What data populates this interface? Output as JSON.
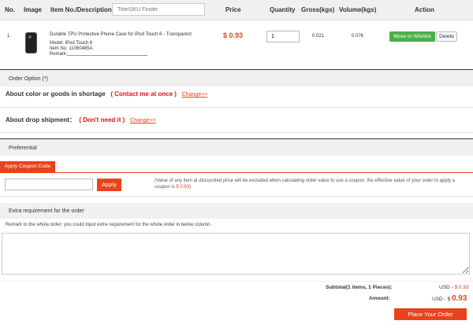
{
  "header": {
    "no": "No.",
    "image": "Image",
    "item": "Item No./Description.",
    "finder_placeholder": "Title/SKU Finder",
    "price": "Price",
    "quantity": "Quantity",
    "gross": "Gross(kgs)",
    "volume": "Volume(kgs)",
    "action": "Action"
  },
  "item": {
    "no": "1",
    "title": "Durable TPU Protective Phone Case for iPod Touch 6 - Transparent",
    "model": "Model: iPod Touch 6",
    "item_no": "Item No: 11060485A",
    "remark_label": "Remark:",
    "price": "$ 0.93",
    "quantity": "1",
    "gross": "0.021",
    "volume": "0.076",
    "wishlist_label": "Move to Wishlist",
    "delete_label": "Delete"
  },
  "order_option": {
    "title": "Order Option (*)",
    "color_label": "About color or goods in shortage",
    "color_value": "( Contact me at once )",
    "color_change": "Change>>",
    "drop_label": "About drop shipment：",
    "drop_value": "( Don't need it )",
    "drop_change": "Change>>"
  },
  "preferential": {
    "title": "Preferential",
    "tab_label": "Apply Coupon Code",
    "apply_label": "Apply",
    "note_text": "(Value of any item at discounted price will be excluded when calculating order value to use a coupon. the effective value of your order to apply a coupon is",
    "note_value": "$ 0.93",
    "note_end": ")"
  },
  "extra": {
    "title": "Extra requirement for the order",
    "remark_text": "Remark to the whole order: you could input extra requirement for the whole order in below column."
  },
  "summary": {
    "subtotal_label": "Subtotal(1 items, 1 Pieces):",
    "subtotal_prefix": "USD - ",
    "subtotal_value": "$ 0.93",
    "amount_label": "Amount:",
    "amount_prefix": "USD - $",
    "amount_value": "0.93",
    "place_order_label": "Place Your Order"
  }
}
